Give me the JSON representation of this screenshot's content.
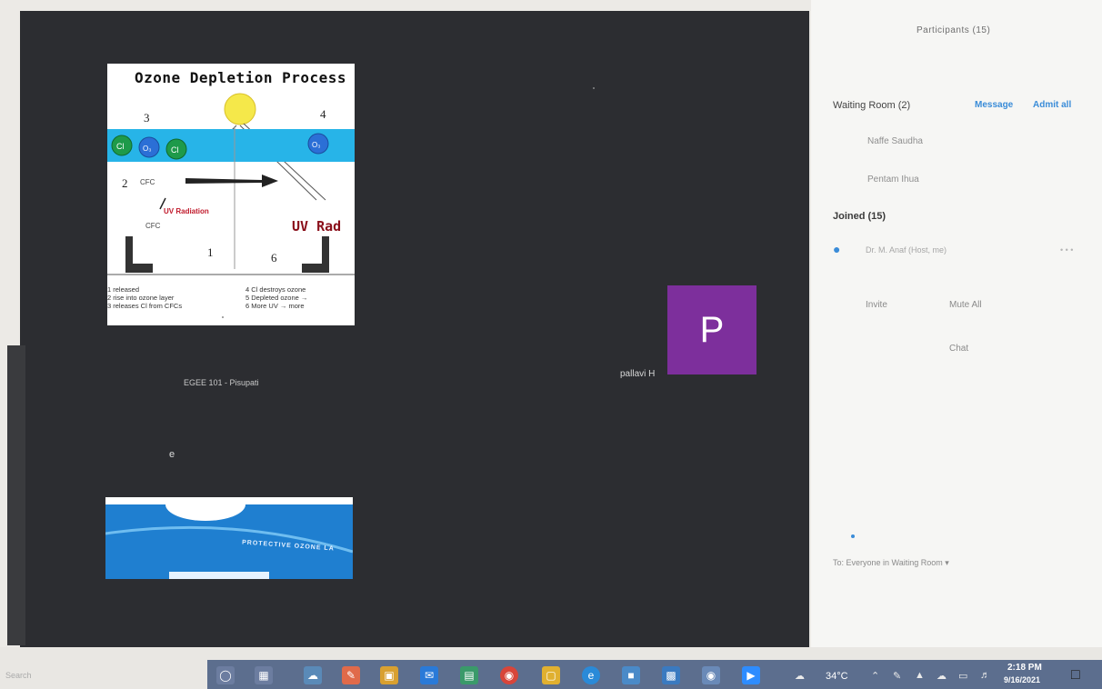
{
  "meeting": {
    "slide": {
      "title": "Ozone Depletion Process",
      "steps": [
        "3",
        "4",
        "2",
        "1",
        "6"
      ],
      "molecule_cl": "Cl",
      "molecule_o3": "O₃",
      "cfc_label": "CFC",
      "uv_small": "UV Radiation",
      "uv_big": "UV Rad",
      "legend_left": [
        "1 released",
        "2 rise into ozone layer",
        "3 releases Cl from CFCs"
      ],
      "legend_right": [
        "4 Cl destroys ozone",
        "5 Depleted ozone →",
        "6 More UV → more"
      ]
    },
    "left_tile_name": "EGEE 101 - Pisupati",
    "left_tile_caption": "e",
    "slide2_text": "PROTECTIVE OZONE LA",
    "avatar_letter": "P",
    "right_tile_name": "pallavi H"
  },
  "participants": {
    "title": "Participants (15)",
    "waiting_room_label": "Waiting Room (2)",
    "message_btn": "Message",
    "admit_all_btn": "Admit all",
    "waiting": [
      "Naffe Saudha",
      "Pentam Ihua"
    ],
    "joined_label": "Joined (15)",
    "joined_first": "Dr. M. Anaf (Host, me)",
    "joined_first_extra": "• • •",
    "invite_btn": "Invite",
    "mute_all_btn": "Mute All",
    "chat_label": "Chat",
    "chat_to": "To: Everyone in Waiting Room ▾"
  },
  "taskbar": {
    "search_hint": "Search",
    "temperature": "34°C",
    "time": "2:18 PM",
    "date": "9/16/2021",
    "icons": [
      "cortana-icon",
      "task-view-icon",
      "weather-app-icon",
      "paint-icon",
      "store-icon",
      "mail-icon",
      "files-icon",
      "chrome-icon",
      "explorer-icon",
      "edge-icon",
      "app-icon-a",
      "app-icon-b",
      "camera-icon",
      "zoom-icon"
    ]
  },
  "colors": {
    "video_bg": "#2c2d31",
    "panel_bg": "#f6f6f4",
    "accent_blue": "#3a8cd8",
    "avatar": "#7d2f9c",
    "taskbar": "#5c6e8e"
  }
}
